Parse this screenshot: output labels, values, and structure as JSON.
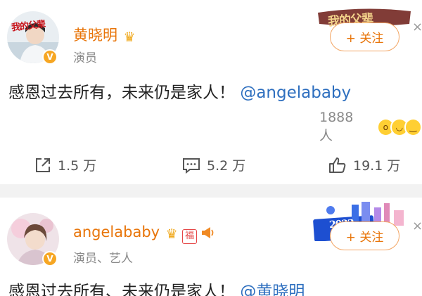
{
  "post1": {
    "avatar_label": "我的父辈",
    "verified_mark": "V",
    "username": "黄晓明",
    "role": "演员",
    "follow_label": "+ 关注",
    "banner_text": "我的父辈",
    "content_text": "感恩过去所有，未来仍是家人！",
    "mention": "@angelababy",
    "reaction_count": "1888 人",
    "actions": {
      "share": "1.5 万",
      "comment": "5.2 万",
      "like": "19.1 万"
    }
  },
  "post2": {
    "verified_mark": "V",
    "username": "angelababy",
    "fu_badge": "福",
    "role": "演员、艺人",
    "follow_label": "+ 关注",
    "banner_text": "2022",
    "content_text": "感恩过去所有、未来仍是家人！",
    "mention": "@黄晓明"
  },
  "colors": {
    "username": "#e8750a",
    "mention": "#2e6fbf",
    "divider": "#f2f2f2",
    "follow_border": "#f3a563",
    "verified": "#f6a623"
  }
}
